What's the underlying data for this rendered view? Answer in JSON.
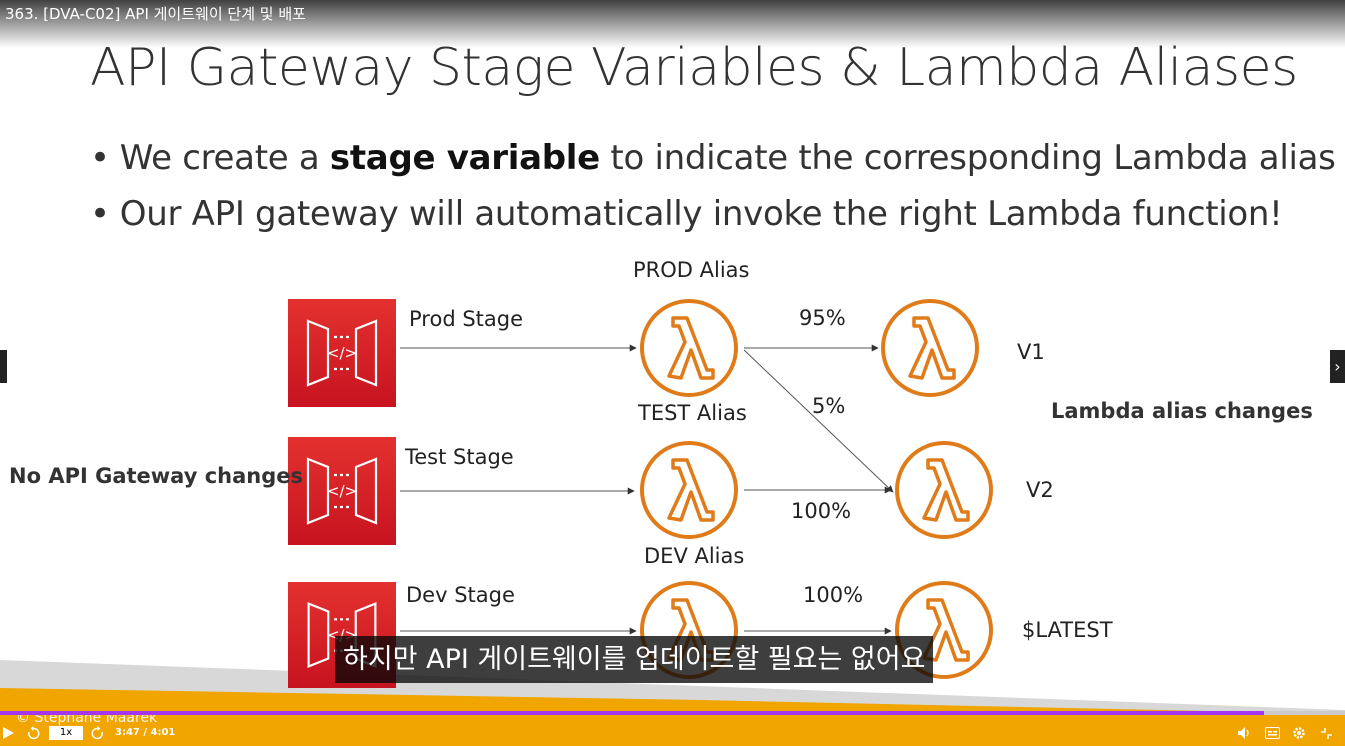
{
  "video": {
    "title": "363. [DVA-C02] API 게이트웨이 단계 및 배포"
  },
  "slide": {
    "title": "API Gateway Stage Variables & Lambda Aliases",
    "bullets": [
      {
        "pre": "We create a ",
        "strong": "stage variable",
        "post": " to indicate the corresponding Lambda alias"
      },
      {
        "pre": "Our API gateway will automatically invoke the right Lambda function!",
        "strong": "",
        "post": ""
      }
    ],
    "diagram": {
      "left_note": "No API Gateway changes",
      "right_note": "Lambda alias changes",
      "stages": [
        "Prod Stage",
        "Test Stage",
        "Dev Stage"
      ],
      "aliases": [
        "PROD Alias",
        "TEST Alias",
        "DEV Alias"
      ],
      "versions": [
        "V1",
        "V2",
        "$LATEST"
      ],
      "weights": {
        "prod_v1": "95%",
        "prod_v2": "5%",
        "test_v2": "100%",
        "dev_latest": "100%"
      }
    },
    "copyright": "© Stephane Maarek"
  },
  "caption": "하지만 API 게이트웨이를 업데이트할 필요는 없어요",
  "player": {
    "speed": "1x",
    "time": "3:47 / 4:01",
    "progress": 0.94,
    "accent_color": "#a435f0",
    "icons": [
      "play-icon",
      "rewind-icon",
      "forward-icon",
      "volume-icon",
      "captions-icon",
      "settings-icon",
      "fullscreen-exit-icon"
    ]
  },
  "colors": {
    "gateway_red": "#d92027",
    "lambda_orange": "#e07b1a",
    "stripe_orange": "#f0a500"
  }
}
